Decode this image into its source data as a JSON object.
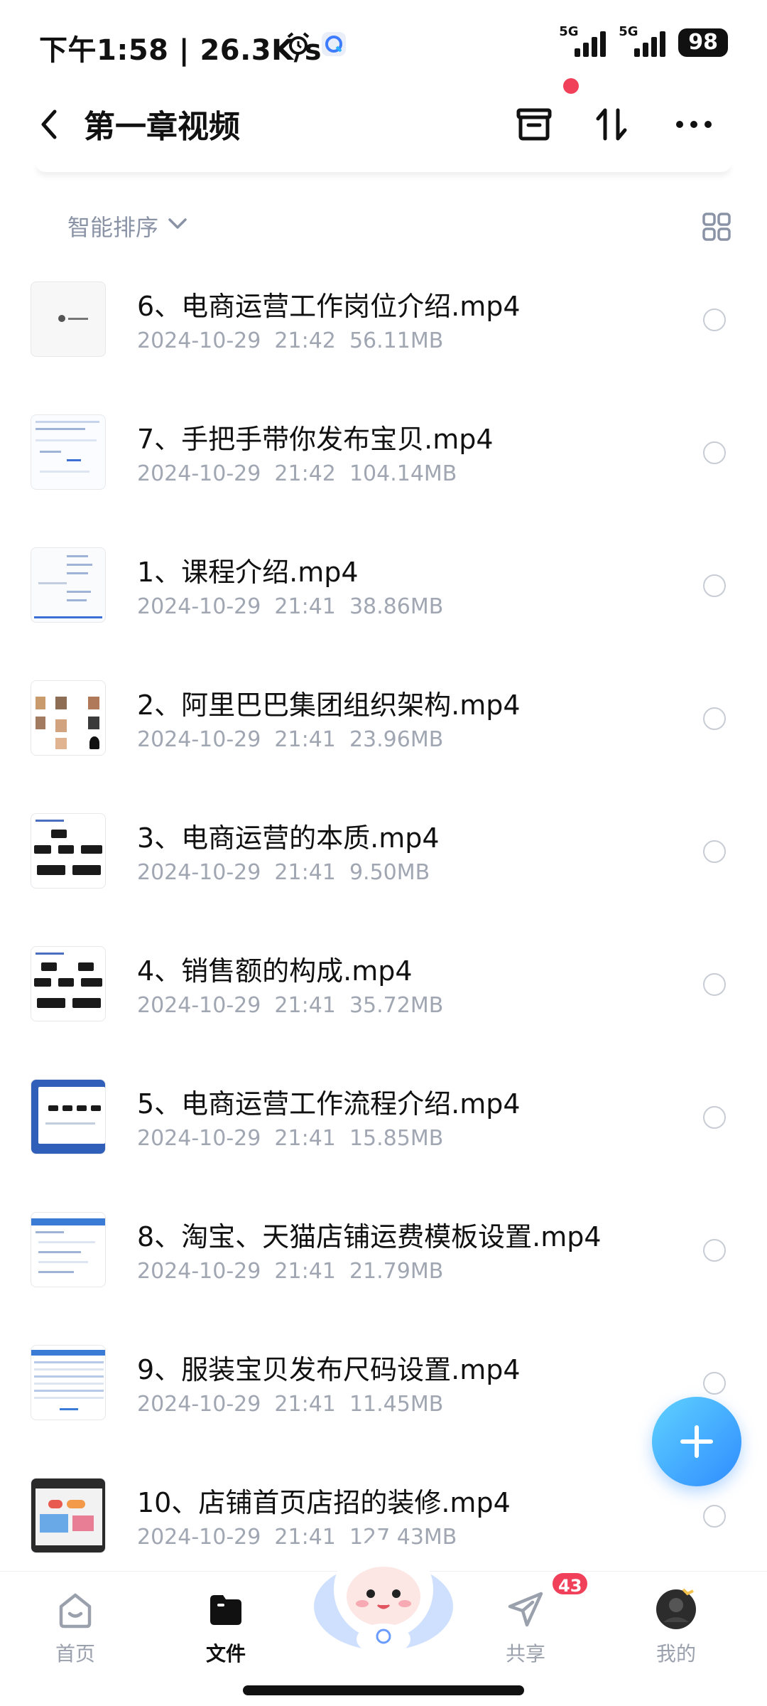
{
  "status_bar": {
    "time_speed": "下午1:58 | 26.3K/s",
    "network_1": "5G",
    "network_2": "5G",
    "battery": "98"
  },
  "header": {
    "title": "第一章视频"
  },
  "sort": {
    "label": "智能排序"
  },
  "files": [
    {
      "name": "6、电商运营工作岗位介绍.mp4",
      "meta": "2024-10-29  21:42  56.11MB"
    },
    {
      "name": "7、手把手带你发布宝贝.mp4",
      "meta": "2024-10-29  21:42  104.14MB"
    },
    {
      "name": "1、课程介绍.mp4",
      "meta": "2024-10-29  21:41  38.86MB"
    },
    {
      "name": "2、阿里巴巴集团组织架构.mp4",
      "meta": "2024-10-29  21:41  23.96MB"
    },
    {
      "name": "3、电商运营的本质.mp4",
      "meta": "2024-10-29  21:41  9.50MB"
    },
    {
      "name": "4、销售额的构成.mp4",
      "meta": "2024-10-29  21:41  35.72MB"
    },
    {
      "name": "5、电商运营工作流程介绍.mp4",
      "meta": "2024-10-29  21:41  15.85MB"
    },
    {
      "name": "8、淘宝、天猫店铺运费模板设置.mp4",
      "meta": "2024-10-29  21:41  21.79MB"
    },
    {
      "name": "9、服装宝贝发布尺码设置.mp4",
      "meta": "2024-10-29  21:41  11.45MB"
    },
    {
      "name": "10、店铺首页店招的装修.mp4",
      "meta": "2024-10-29  21:41  127.43MB"
    }
  ],
  "bottom_nav": {
    "home": "首页",
    "files": "文件",
    "share": "共享",
    "me": "我的",
    "share_badge": "43"
  },
  "colors": {
    "accent": "#2f8cff",
    "badge": "#f0405a",
    "meta_text": "#a0a6b2"
  }
}
